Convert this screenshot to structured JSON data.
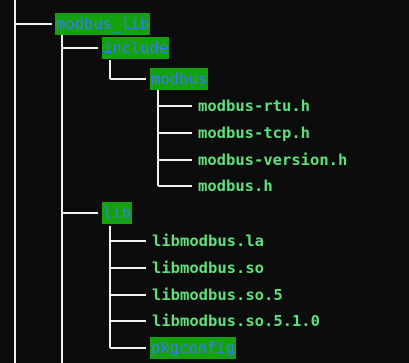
{
  "terminal": {
    "colors": {
      "background": "#0c0c0c",
      "tree_lines": "#f2f2f2",
      "dir_background": "#13a10e",
      "dir_text": "#3b78ff",
      "file_text": "#5ee07a"
    },
    "tree": {
      "modbus_lib": "modbus_lib",
      "include": "include",
      "modbus": "modbus",
      "modbus_files": [
        "modbus-rtu.h",
        "modbus-tcp.h",
        "modbus-version.h",
        "modbus.h"
      ],
      "lib": "lib",
      "lib_files": [
        "libmodbus.la",
        "libmodbus.so",
        "libmodbus.so.5",
        "libmodbus.so.5.1.0"
      ],
      "pkgconfig": "pkgconfig"
    }
  }
}
